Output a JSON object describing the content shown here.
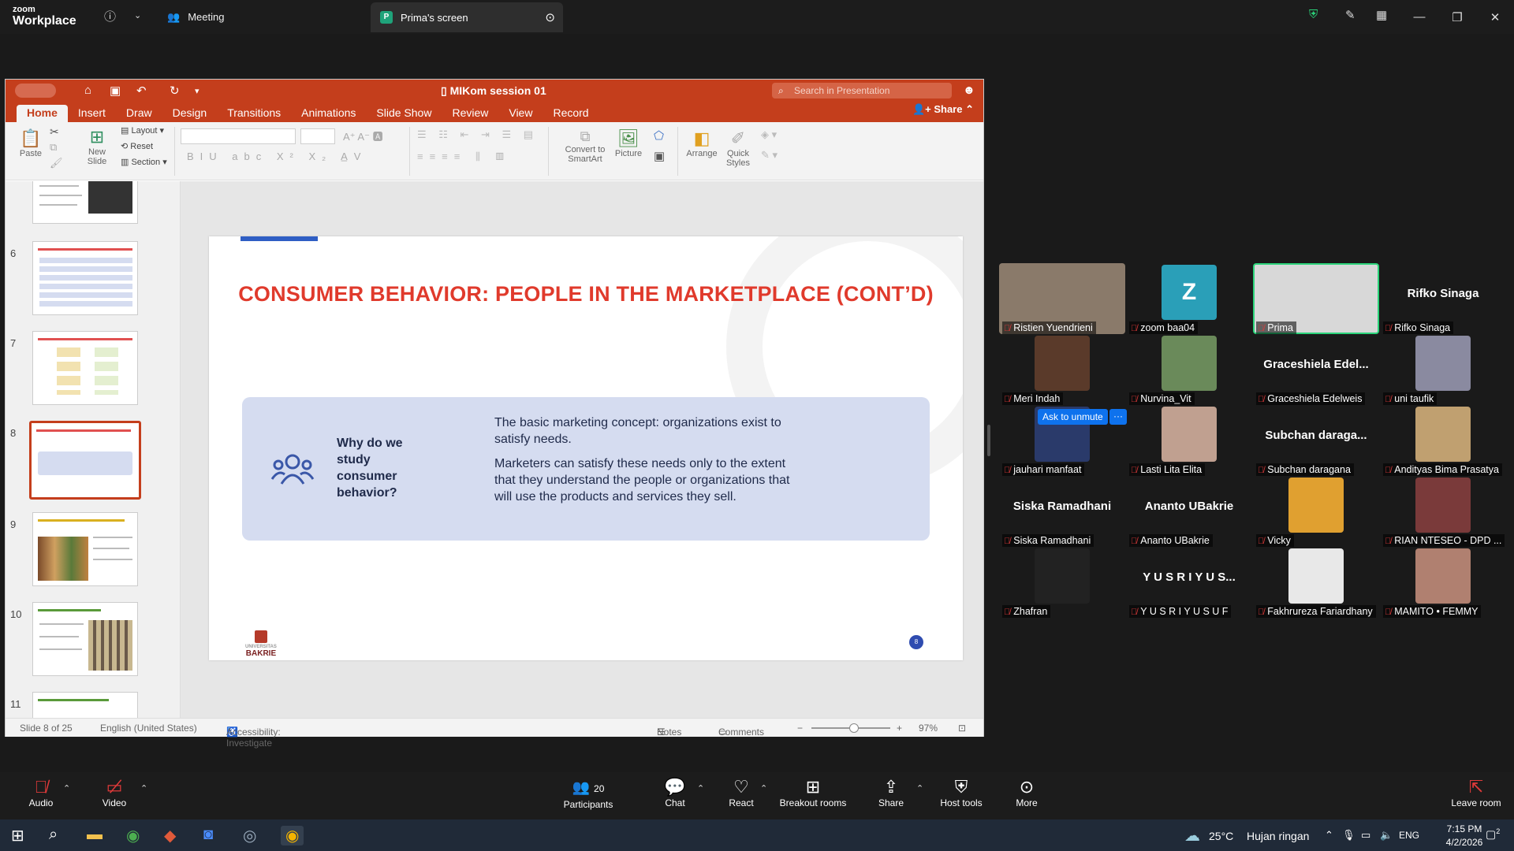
{
  "zoom": {
    "logo_top": "zoom",
    "logo_bottom": "Workplace",
    "meeting_tab": "Meeting",
    "screen_tab_initial": "P",
    "screen_tab": "Prima's screen"
  },
  "ppt": {
    "doc_title": "MIKom session 01",
    "search_placeholder": "Search in Presentation",
    "tabs": [
      "Home",
      "Insert",
      "Draw",
      "Design",
      "Transitions",
      "Animations",
      "Slide Show",
      "Review",
      "View",
      "Record"
    ],
    "share": "Share",
    "ribbon": {
      "paste": "Paste",
      "new_slide": "New Slide",
      "layout": "Layout",
      "reset": "Reset",
      "section": "Section",
      "convert": "Convert to SmartArt",
      "picture": "Picture",
      "arrange": "Arrange",
      "quick_styles": "Quick Styles"
    },
    "thumb_numbers": [
      "6",
      "7",
      "8",
      "9",
      "10",
      "11"
    ],
    "slide": {
      "title": "CONSUMER BEHAVIOR: PEOPLE IN THE MARKETPLACE (CONT’D)",
      "question": "Why do we study consumer behavior?",
      "text1": "The basic marketing concept: organizations exist to satisfy needs.",
      "text2": "Marketers can satisfy these needs only to the extent that they understand the people or organizations that will use the products and services they sell.",
      "logo": "BAKRIE",
      "logo_small": "UNIVERSITAS",
      "page": "8"
    },
    "status": {
      "slide_of": "Slide 8 of 25",
      "language": "English (United States)",
      "accessibility": "Accessibility: Investigate",
      "notes": "Notes",
      "comments": "Comments",
      "zoom": "97%"
    }
  },
  "participants_gallery": [
    {
      "name": "Ristien Yuendrieni",
      "big": "",
      "video": true
    },
    {
      "name": "zoom baa04",
      "big": "Z",
      "video": false
    },
    {
      "name": "Prima",
      "big": "",
      "video": true,
      "active": true
    },
    {
      "name": "Rifko Sinaga",
      "big": "Rifko Sinaga",
      "video": false
    },
    {
      "name": "Meri Indah",
      "big": "",
      "video": true
    },
    {
      "name": "Nurvina_Vit",
      "big": "",
      "video": true
    },
    {
      "name": "Graceshiela Edelweis",
      "big": "Graceshiela  Edel...",
      "video": false
    },
    {
      "name": "uni taufik",
      "big": "",
      "video": true
    },
    {
      "name": "jauhari manfaat",
      "big": "",
      "video": true
    },
    {
      "name": "Lasti Lita Elita",
      "big": "",
      "video": true
    },
    {
      "name": "Subchan daragana",
      "big": "Subchan  daraga...",
      "video": false
    },
    {
      "name": "Andityas Bima Prasatya",
      "big": "",
      "video": true
    },
    {
      "name": "Siska Ramadhani",
      "big": "Siska Ramadhani",
      "video": false
    },
    {
      "name": "Ananto UBakrie",
      "big": "Ananto UBakrie",
      "video": false
    },
    {
      "name": "Vicky",
      "big": "",
      "video": true
    },
    {
      "name": "RIAN NTESEO - DPD ...",
      "big": "",
      "video": true
    },
    {
      "name": "Zhafran",
      "big": "",
      "video": true
    },
    {
      "name": "Y U S R I  Y U S U F",
      "big": "Y U S R I  Y U S...",
      "video": false
    },
    {
      "name": "Fakhrureza Fariardhany",
      "big": "",
      "video": true
    },
    {
      "name": "MAMITO • FEMMY",
      "big": "",
      "video": true
    }
  ],
  "ask_to_unmute": "Ask to unmute",
  "ask_more": "···",
  "toolbar": {
    "audio": "Audio",
    "video": "Video",
    "participants": "Participants",
    "participants_count": "20",
    "chat": "Chat",
    "react": "React",
    "breakout": "Breakout rooms",
    "share": "Share",
    "host_tools": "Host tools",
    "more": "More",
    "leave": "Leave room"
  },
  "taskbar": {
    "weather_temp": "25°C",
    "weather_text": "Hujan ringan",
    "lang": "ENG",
    "time": "7:15 PM",
    "date": "4/2/2026",
    "notif_count": "2"
  },
  "colors": {
    "ppt_accent": "#c43e1c",
    "slide_title": "#e03a2c",
    "zoom_blue": "#0e72ed",
    "muted_red": "#e03a3a"
  }
}
